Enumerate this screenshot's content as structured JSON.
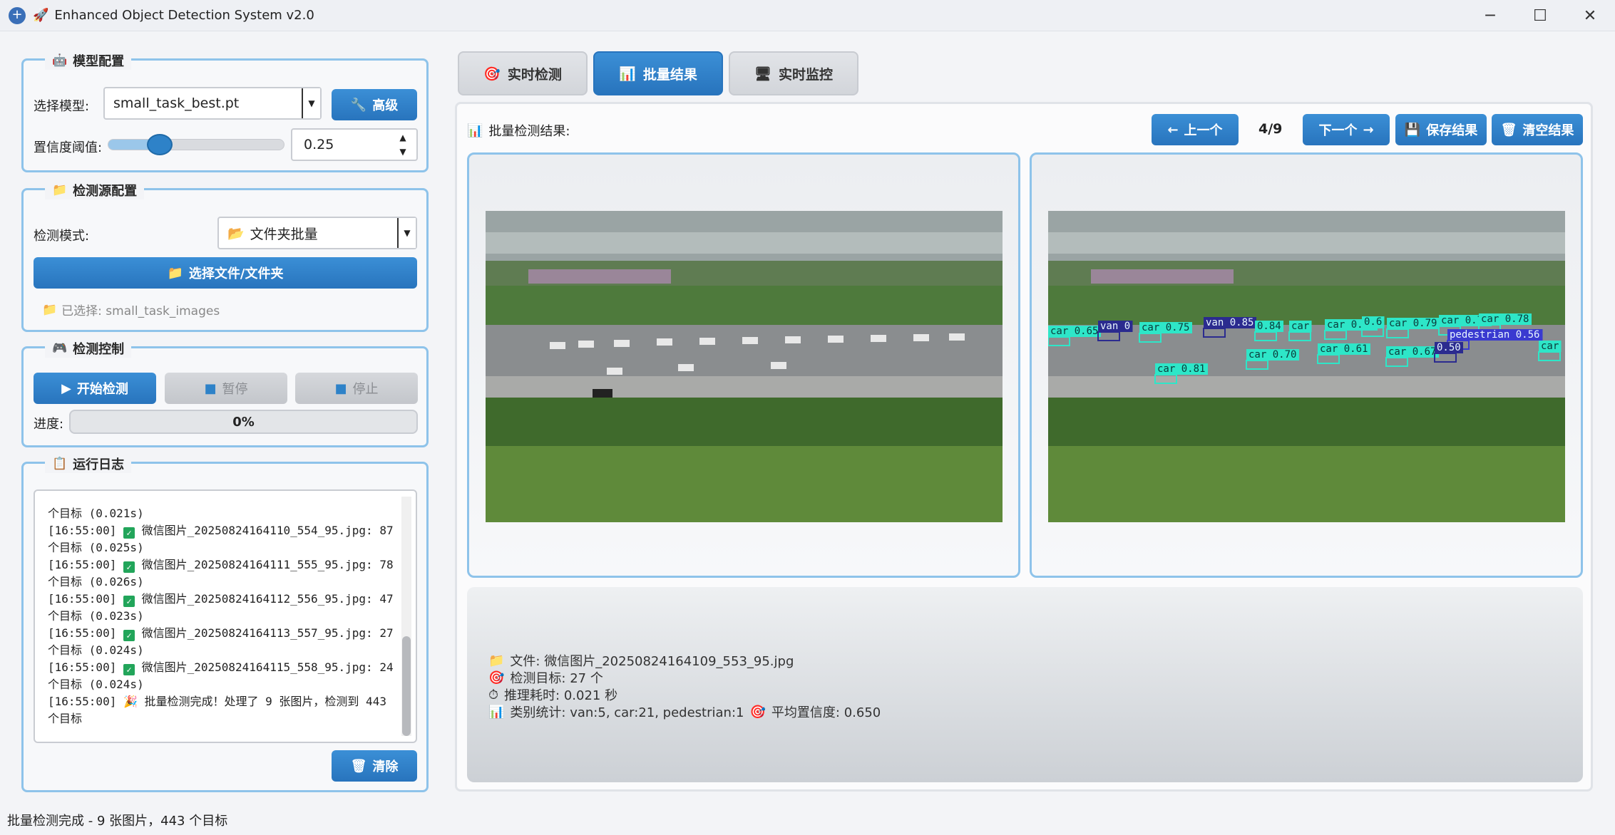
{
  "window": {
    "title": "Enhanced Object Detection System v2.0",
    "controls": {
      "minimize": "─",
      "maximize": "☐",
      "close": "✕"
    }
  },
  "model_config": {
    "title": "模型配置",
    "model_label": "选择模型:",
    "model_value": "small_task_best.pt",
    "advanced_button": "高级",
    "confidence_label": "置信度阈值:",
    "confidence_value": "0.25",
    "confidence_slider_fraction": 0.25
  },
  "source_config": {
    "title": "检测源配置",
    "mode_label": "检测模式:",
    "mode_value": "文件夹批量",
    "select_button": "选择文件/文件夹",
    "selected_text": "已选择: small_task_images"
  },
  "control": {
    "title": "检测控制",
    "start_button": "开始检测",
    "pause_button": "暂停",
    "stop_button": "停止",
    "progress_label": "进度:",
    "progress_text": "0%",
    "progress_value": 0
  },
  "log": {
    "title": "运行日志",
    "partial_top": "个目标 (0.021s)",
    "entries": [
      {
        "time": "[16:55:00]",
        "text": "微信图片_20250824164110_554_95.jpg: 87 个目标 (0.025s)"
      },
      {
        "time": "[16:55:00]",
        "text": "微信图片_20250824164111_555_95.jpg: 78 个目标 (0.026s)"
      },
      {
        "time": "[16:55:00]",
        "text": "微信图片_20250824164112_556_95.jpg: 47 个目标 (0.023s)"
      },
      {
        "time": "[16:55:00]",
        "text": "微信图片_20250824164113_557_95.jpg: 27 个目标 (0.024s)"
      },
      {
        "time": "[16:55:00]",
        "text": "微信图片_20250824164115_558_95.jpg: 24 个目标 (0.024s)"
      }
    ],
    "final": {
      "time": "[16:55:00]",
      "text": "批量检测完成！处理了 9 张图片，检测到 443 个目标"
    },
    "clear_button": "清除"
  },
  "tabs": [
    {
      "label": "实时检测",
      "icon": "target-icon",
      "active": false
    },
    {
      "label": "批量结果",
      "icon": "chart-icon",
      "active": true
    },
    {
      "label": "实时监控",
      "icon": "monitor-icon",
      "active": false
    }
  ],
  "batch": {
    "header": "批量检测结果:",
    "prev_button": "上一个",
    "counter": "4/9",
    "next_button": "下一个",
    "save_button": "保存结果",
    "clear_button": "清空结果"
  },
  "detections": [
    {
      "label": "car 0.65"
    },
    {
      "label": "van 0"
    },
    {
      "label": "car 0.75"
    },
    {
      "label": "van 0.85"
    },
    {
      "label": "0.84"
    },
    {
      "label": "car"
    },
    {
      "label": "car 0.74"
    },
    {
      "label": "0.6"
    },
    {
      "label": "car 0.79"
    },
    {
      "label": "car 0.77"
    },
    {
      "label": "car 0.78"
    },
    {
      "label": "pedestrian 0.56"
    },
    {
      "label": "car 0.70"
    },
    {
      "label": "car 0.61"
    },
    {
      "label": "car 0.67"
    },
    {
      "label": "0.50"
    },
    {
      "label": "car 0.81"
    },
    {
      "label": "car"
    }
  ],
  "info": {
    "file": "文件: 微信图片_20250824164109_553_95.jpg",
    "targets": "检测目标: 27 个",
    "time": "推理耗时: 0.021 秒",
    "stats": "类别统计: van:5, car:21, pedestrian:1",
    "avg_conf": "平均置信度: 0.650"
  },
  "statusbar": "批量检测完成 - 9 张图片，443 个目标",
  "colors": {
    "accent": "#2e82c8",
    "border": "#8ec3ea",
    "car_box": "#2ee6c8",
    "van_box": "#2b2b8f"
  }
}
